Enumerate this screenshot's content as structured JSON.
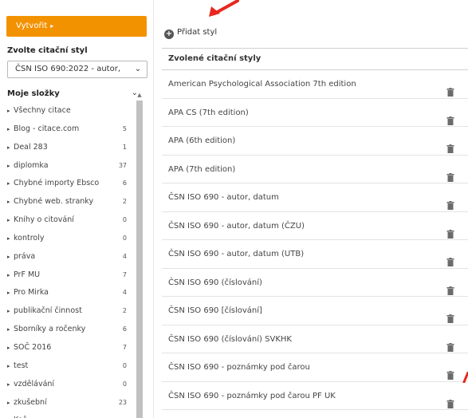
{
  "colors": {
    "accent": "#f39200",
    "annotation": "#e8281e"
  },
  "sidebar": {
    "create_button": "Vytvořit",
    "style_label": "Zvolte citační styl",
    "style_select_value": "ČSN ISO 690:2022 - autor, ",
    "folders_title": "Moje složky",
    "folders": [
      {
        "label": "Všechny citace",
        "count": ""
      },
      {
        "label": "Blog - citace.com",
        "count": "5"
      },
      {
        "label": "Deal 283",
        "count": "1"
      },
      {
        "label": "diplomka",
        "count": "37"
      },
      {
        "label": "Chybné importy Ebsco",
        "count": "6"
      },
      {
        "label": "Chybné web. stranky",
        "count": "2"
      },
      {
        "label": "Knihy o citování",
        "count": "0"
      },
      {
        "label": "kontroly",
        "count": "0"
      },
      {
        "label": "práva",
        "count": "4"
      },
      {
        "label": "PrF MU",
        "count": "7"
      },
      {
        "label": "Pro Mirka",
        "count": "4"
      },
      {
        "label": "publikační činnost",
        "count": "2"
      },
      {
        "label": "Sborníky a ročenky",
        "count": "6"
      },
      {
        "label": "SOČ 2016",
        "count": "7"
      },
      {
        "label": "test",
        "count": "0"
      },
      {
        "label": "vzdělávání",
        "count": "0"
      },
      {
        "label": "zkušební",
        "count": "23"
      },
      {
        "label": "Koš",
        "count": ""
      }
    ]
  },
  "main": {
    "add_style_label": "Přidat styl",
    "table_header": "Zvolené citační styly",
    "styles": [
      "American Psychological Association 7th edition",
      "APA CS (7th edition)",
      "APA (6th edition)",
      "APA (7th edition)",
      "ČSN ISO 690 - autor, datum",
      "ČSN ISO 690 - autor, datum (ČZU)",
      "ČSN ISO 690 - autor, datum (UTB)",
      "ČSN ISO 690 (číslování)",
      "ČSN ISO 690 [číslování]",
      "ČSN ISO 690 (číslování) SVKHK",
      "ČSN ISO 690 - poznámky pod čarou",
      "ČSN ISO 690 - poznámky pod čarou PF UK"
    ]
  }
}
